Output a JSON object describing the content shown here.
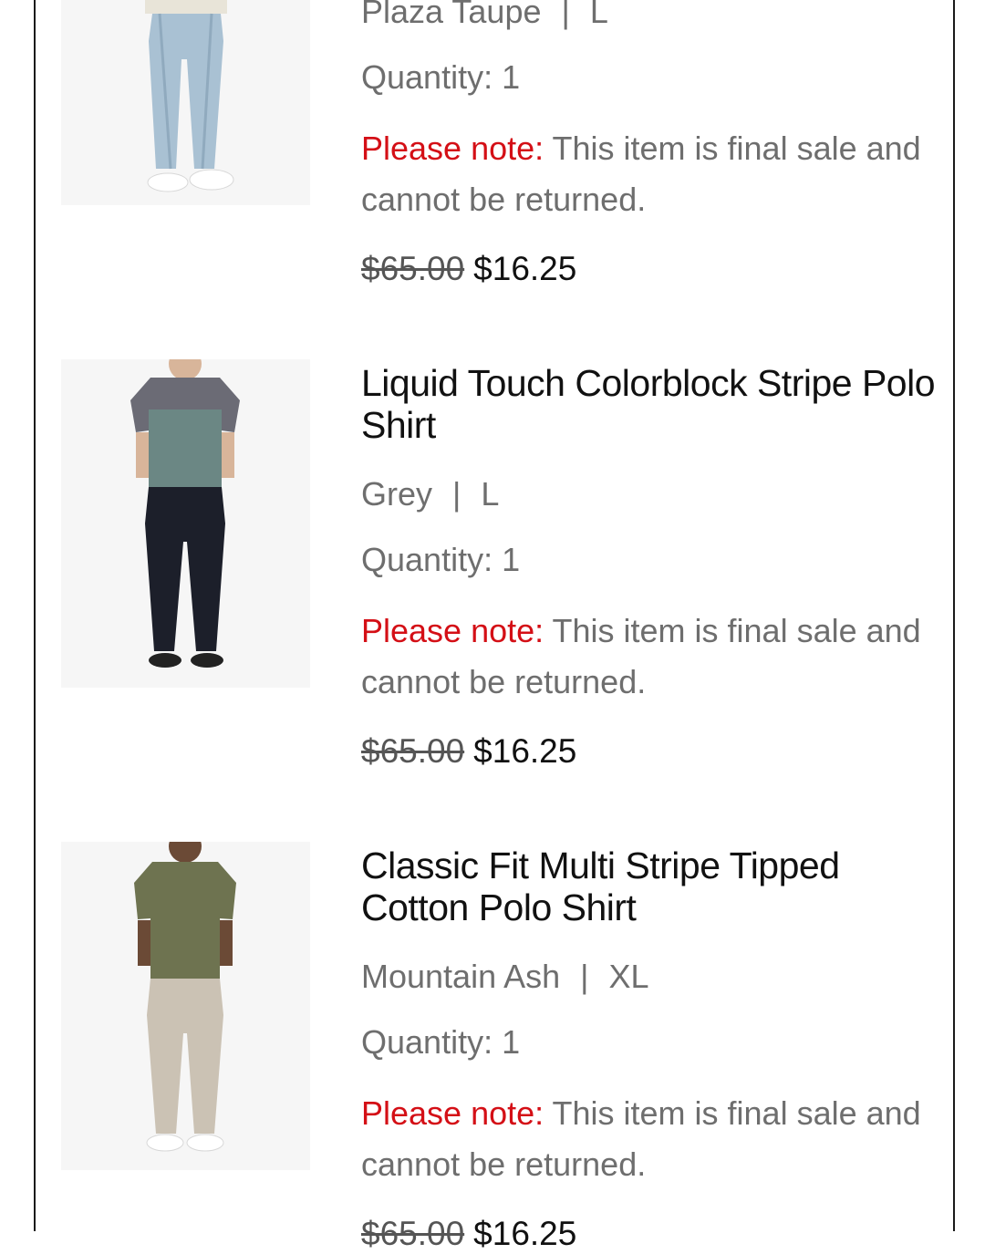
{
  "items": [
    {
      "title": "",
      "color": "Plaza Taupe",
      "size": "L",
      "quantity_text": "Quantity: 1",
      "note_label": "Please note:",
      "note_text": "This item is final sale and cannot be returned.",
      "original_price": "$65.00",
      "sale_price": "$16.25",
      "image": "product-photo-jeans"
    },
    {
      "title": "Liquid Touch Colorblock Stripe Polo Shirt",
      "color": "Grey",
      "size": "L",
      "quantity_text": "Quantity: 1",
      "note_label": "Please note:",
      "note_text": "This item is final sale and cannot be returned.",
      "original_price": "$65.00",
      "sale_price": "$16.25",
      "image": "product-photo-grey-polo"
    },
    {
      "title": "Classic Fit Multi Stripe Tipped Cotton Polo Shirt",
      "color": "Mountain Ash",
      "size": "XL",
      "quantity_text": "Quantity: 1",
      "note_label": "Please note:",
      "note_text": "This item is final sale and cannot be returned.",
      "original_price": "$65.00",
      "sale_price": "$16.25",
      "image": "product-photo-olive-polo"
    }
  ],
  "separator": "|",
  "colors": {
    "note_label": "#d40f16",
    "muted_text": "#6e6e6e",
    "text": "#111111",
    "thumb_bg": "#f6f6f6"
  }
}
